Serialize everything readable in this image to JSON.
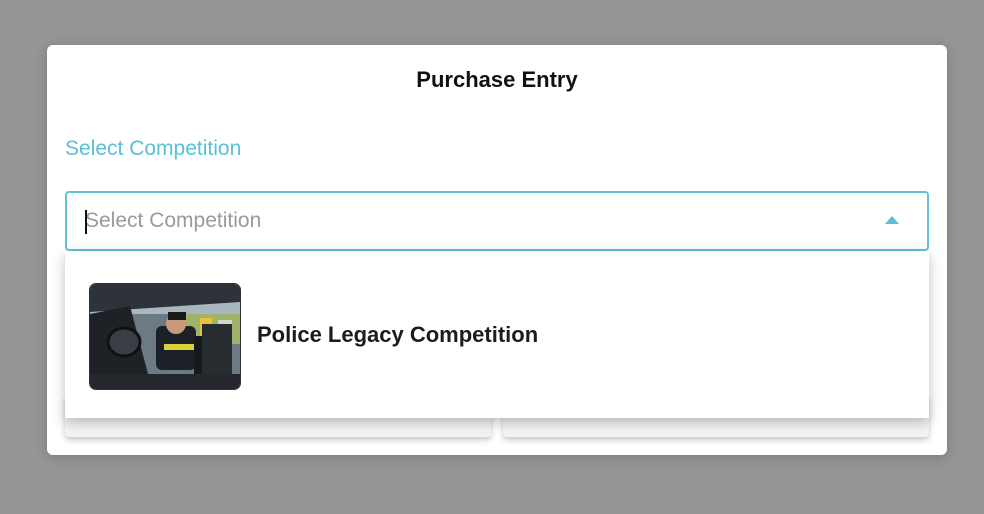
{
  "modal": {
    "title": "Purchase Entry",
    "field_label": "Select Competition",
    "select": {
      "placeholder": "Select Competition",
      "value": ""
    }
  },
  "dropdown": {
    "options": [
      {
        "label": "Police Legacy Competition",
        "thumbnail": "police-car-photo"
      }
    ]
  },
  "colors": {
    "accent": "#5bbfd7",
    "overlay": "#959595",
    "title_text": "#111111"
  }
}
